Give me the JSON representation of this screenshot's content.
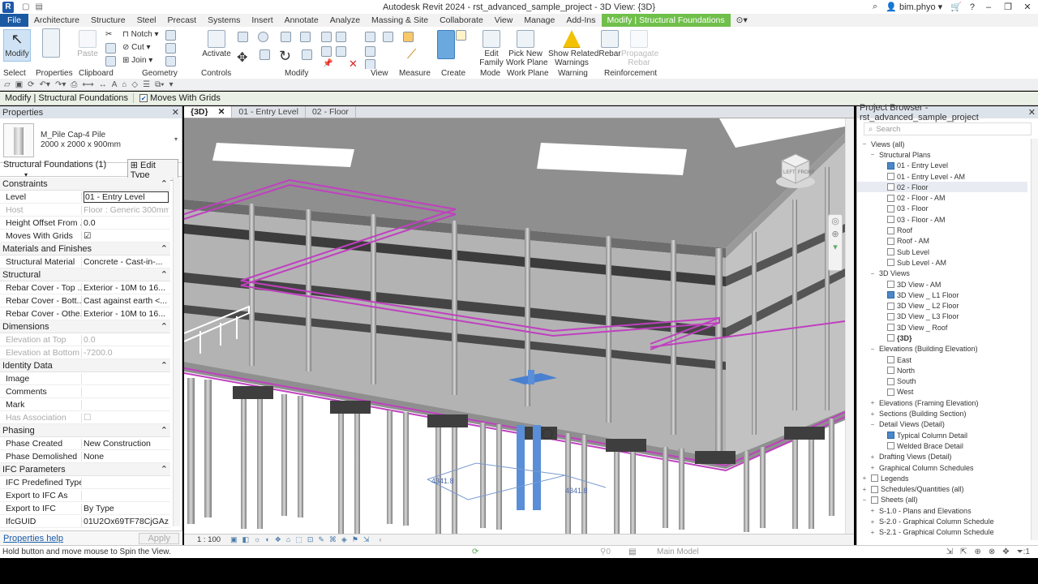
{
  "app": {
    "logo_letter": "R",
    "title": "Autodesk Revit 2024 - rst_advanced_sample_project - 3D View: {3D}",
    "user": "bim.phyo"
  },
  "menu": [
    "File",
    "Architecture",
    "Structure",
    "Steel",
    "Precast",
    "Systems",
    "Insert",
    "Annotate",
    "Analyze",
    "Massing & Site",
    "Collaborate",
    "View",
    "Manage",
    "Add-Ins",
    "Modify | Structural Foundations"
  ],
  "ribbon": {
    "modify": "Modify",
    "paste": "Paste",
    "notch": "Notch",
    "cut": "Cut",
    "join": "Join",
    "activate": "Activate",
    "edit_family": [
      "Edit",
      "Family"
    ],
    "pick_new": [
      "Pick New",
      "Work Plane"
    ],
    "show_related": [
      "Show Related",
      "Warnings"
    ],
    "rebar": "Rebar",
    "propagate": [
      "Propagate",
      "Rebar"
    ],
    "panels": [
      "Select",
      "Properties",
      "Clipboard",
      "Geometry",
      "Controls",
      "Modify",
      "View",
      "Measure",
      "Create",
      "Mode",
      "Work Plane",
      "Warning",
      "Reinforcement"
    ]
  },
  "context_bar": {
    "title": "Modify | Structural Foundations",
    "moves_with_grids": "Moves With Grids"
  },
  "properties": {
    "header": "Properties",
    "type_name": "M_Pile Cap-4 Pile",
    "type_size": "2000 x 2000 x 900mm",
    "instance_filter": "Structural Foundations (1)",
    "edit_type": "Edit Type",
    "groups": [
      {
        "name": "Constraints",
        "rows": [
          {
            "n": "Level",
            "v": "01 - Entry Level",
            "boxed": true
          },
          {
            "n": "Host",
            "v": "Floor : Generic 300mm",
            "dim": true
          },
          {
            "n": "Height Offset From ...",
            "v": "0.0"
          },
          {
            "n": "Moves With Grids",
            "v": "☑"
          }
        ]
      },
      {
        "name": "Materials and Finishes",
        "rows": [
          {
            "n": "Structural Material",
            "v": "Concrete - Cast-in-..."
          }
        ]
      },
      {
        "name": "Structural",
        "rows": [
          {
            "n": "Rebar Cover - Top ...",
            "v": "Exterior - 10M to 16..."
          },
          {
            "n": "Rebar Cover - Bott...",
            "v": "Cast against earth <..."
          },
          {
            "n": "Rebar Cover - Othe...",
            "v": "Exterior - 10M to 16..."
          }
        ]
      },
      {
        "name": "Dimensions",
        "rows": [
          {
            "n": "Elevation at Top",
            "v": "0.0",
            "dim": true
          },
          {
            "n": "Elevation at Bottom",
            "v": "-7200.0",
            "dim": true
          }
        ]
      },
      {
        "name": "Identity Data",
        "rows": [
          {
            "n": "Image",
            "v": ""
          },
          {
            "n": "Comments",
            "v": ""
          },
          {
            "n": "Mark",
            "v": ""
          },
          {
            "n": "Has Association",
            "v": "☐",
            "dim": true
          }
        ]
      },
      {
        "name": "Phasing",
        "rows": [
          {
            "n": "Phase Created",
            "v": "New Construction"
          },
          {
            "n": "Phase Demolished",
            "v": "None"
          }
        ]
      },
      {
        "name": "IFC Parameters",
        "rows": [
          {
            "n": "IFC Predefined Type",
            "v": ""
          },
          {
            "n": "Export to IFC As",
            "v": ""
          },
          {
            "n": "Export to IFC",
            "v": "By Type"
          },
          {
            "n": "IfcGUID",
            "v": "01U2Ox69TF78CjGAz..."
          }
        ]
      }
    ],
    "help": "Properties help",
    "apply": "Apply"
  },
  "view_tabs": [
    "{3D}",
    "01 - Entry Level",
    "02 - Floor"
  ],
  "view": {
    "scale": "1 : 100",
    "cube_left": "LEFT",
    "cube_front": "FRONT",
    "dim1": "4341.8",
    "dim2": "4341.8"
  },
  "browser": {
    "header": "Project Browser - rst_advanced_sample_project",
    "search": "Search",
    "tree": [
      {
        "l": 0,
        "t": "Views (all)",
        "tog": "−"
      },
      {
        "l": 1,
        "t": "Structural Plans",
        "tog": "−"
      },
      {
        "l": 2,
        "t": "01 - Entry Level",
        "icon": "active"
      },
      {
        "l": 2,
        "t": "01 - Entry Level - AM",
        "icon": "plain"
      },
      {
        "l": 2,
        "t": "02 - Floor",
        "icon": "plain",
        "hl": true
      },
      {
        "l": 2,
        "t": "02 - Floor - AM",
        "icon": "plain"
      },
      {
        "l": 2,
        "t": "03 - Floor",
        "icon": "plain"
      },
      {
        "l": 2,
        "t": "03 - Floor - AM",
        "icon": "plain"
      },
      {
        "l": 2,
        "t": "Roof",
        "icon": "plain"
      },
      {
        "l": 2,
        "t": "Roof - AM",
        "icon": "plain"
      },
      {
        "l": 2,
        "t": "Sub Level",
        "icon": "plain"
      },
      {
        "l": 2,
        "t": "Sub Level - AM",
        "icon": "plain"
      },
      {
        "l": 1,
        "t": "3D Views",
        "tog": "−"
      },
      {
        "l": 2,
        "t": "3D View - AM",
        "icon": "plain"
      },
      {
        "l": 2,
        "t": "3D View _ L1 Floor",
        "icon": "active"
      },
      {
        "l": 2,
        "t": "3D View _ L2 Floor",
        "icon": "plain"
      },
      {
        "l": 2,
        "t": "3D View _ L3 Floor",
        "icon": "plain"
      },
      {
        "l": 2,
        "t": "3D View _ Roof",
        "icon": "plain"
      },
      {
        "l": 2,
        "t": "{3D}",
        "icon": "plain",
        "bold": true
      },
      {
        "l": 1,
        "t": "Elevations (Building Elevation)",
        "tog": "−"
      },
      {
        "l": 2,
        "t": "East",
        "icon": "plain"
      },
      {
        "l": 2,
        "t": "North",
        "icon": "plain"
      },
      {
        "l": 2,
        "t": "South",
        "icon": "plain"
      },
      {
        "l": 2,
        "t": "West",
        "icon": "plain"
      },
      {
        "l": 1,
        "t": "Elevations (Framing Elevation)",
        "tog": "+"
      },
      {
        "l": 1,
        "t": "Sections (Building Section)",
        "tog": "+"
      },
      {
        "l": 1,
        "t": "Detail Views (Detail)",
        "tog": "−"
      },
      {
        "l": 2,
        "t": "Typical Column Detail",
        "icon": "active"
      },
      {
        "l": 2,
        "t": "Welded Brace Detail",
        "icon": "plain"
      },
      {
        "l": 1,
        "t": "Drafting Views (Detail)",
        "tog": "+"
      },
      {
        "l": 1,
        "t": "Graphical Column Schedules",
        "tog": "+"
      },
      {
        "l": 0,
        "t": "Legends",
        "tog": "+"
      },
      {
        "l": 0,
        "t": "Schedules/Quantities (all)",
        "tog": "+"
      },
      {
        "l": 0,
        "t": "Sheets (all)",
        "tog": "−"
      },
      {
        "l": 1,
        "t": "S-1.0 - Plans and Elevations",
        "tog": "+"
      },
      {
        "l": 1,
        "t": "S-2.0 - Graphical Column Schedule",
        "tog": "+"
      },
      {
        "l": 1,
        "t": "S-2.1 - Graphical Column Schedule",
        "tog": "+"
      }
    ]
  },
  "status": {
    "text": "Hold button and move mouse to Spin the View.",
    "model": "Main Model",
    "filter_count": ":1"
  },
  "colors": {
    "accent": "#1b5aa3",
    "context_tab": "#6fbf4a",
    "magenta": "#c040c0"
  }
}
